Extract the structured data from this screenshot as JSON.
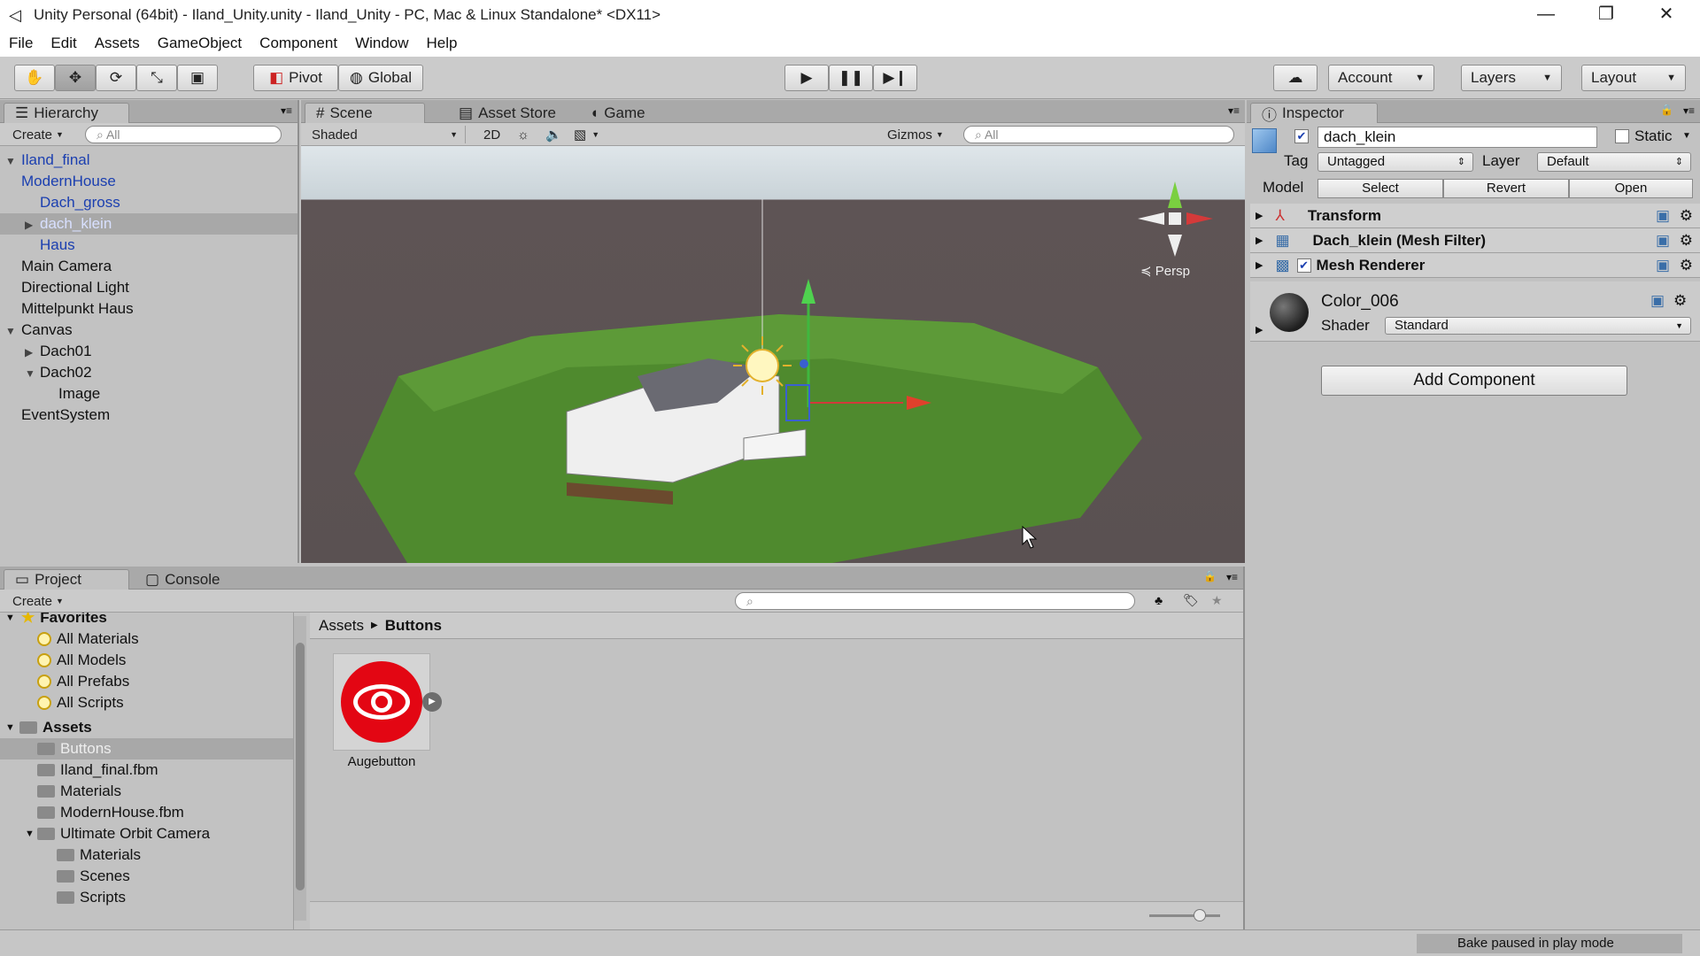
{
  "window": {
    "title": "Unity Personal (64bit) - Iland_Unity.unity - Iland_Unity - PC, Mac & Linux Standalone* <DX11>",
    "minimize": "—",
    "restore": "❐",
    "close": "✕"
  },
  "menu": [
    "File",
    "Edit",
    "Assets",
    "GameObject",
    "Component",
    "Window",
    "Help"
  ],
  "toolbar": {
    "pivot": "Pivot",
    "global": "Global",
    "account": "Account",
    "layers": "Layers",
    "layout": "Layout"
  },
  "hierarchy": {
    "tab": "Hierarchy",
    "create": "Create",
    "search_placeholder": "All",
    "items": [
      {
        "label": "Iland_final"
      },
      {
        "label": "ModernHouse"
      },
      {
        "label": "Dach_gross"
      },
      {
        "label": "dach_klein"
      },
      {
        "label": "Haus"
      },
      {
        "label": "Main Camera"
      },
      {
        "label": "Directional Light"
      },
      {
        "label": "Mittelpunkt Haus"
      },
      {
        "label": "Canvas"
      },
      {
        "label": "Dach01"
      },
      {
        "label": "Dach02"
      },
      {
        "label": "Image"
      },
      {
        "label": "EventSystem"
      }
    ]
  },
  "scene": {
    "tabs": [
      "Scene",
      "Asset Store",
      "Game"
    ],
    "shading": "Shaded",
    "mode_2d": "2D",
    "gizmos": "Gizmos",
    "search_placeholder": "All",
    "persp": "Persp"
  },
  "inspector": {
    "tab": "Inspector",
    "object_name": "dach_klein",
    "static_label": "Static",
    "tag_label": "Tag",
    "tag_value": "Untagged",
    "layer_label": "Layer",
    "layer_value": "Default",
    "model_label": "Model",
    "select": "Select",
    "revert": "Revert",
    "open": "Open",
    "components": [
      "Transform",
      "Dach_klein (Mesh Filter)",
      "Mesh Renderer"
    ],
    "material_name": "Color_006",
    "shader_label": "Shader",
    "shader_value": "Standard",
    "add_component": "Add Component"
  },
  "project": {
    "tabs": [
      "Project",
      "Console"
    ],
    "create": "Create",
    "favorites_label": "Favorites",
    "favorites": [
      "All Materials",
      "All Models",
      "All Prefabs",
      "All Scripts"
    ],
    "assets_label": "Assets",
    "assets": [
      "Buttons",
      "Iland_final.fbm",
      "Materials",
      "ModernHouse.fbm",
      "Ultimate Orbit Camera",
      "Materials",
      "Scenes",
      "Scripts"
    ],
    "breadcrumb": [
      "Assets",
      "Buttons"
    ],
    "asset_tile": "Augebutton"
  },
  "status": {
    "text": "Bake paused in play mode"
  },
  "colors": {
    "accent_blue": "#1b3fb0",
    "selection": "#a8a8a8",
    "button_red": "#e30613"
  }
}
